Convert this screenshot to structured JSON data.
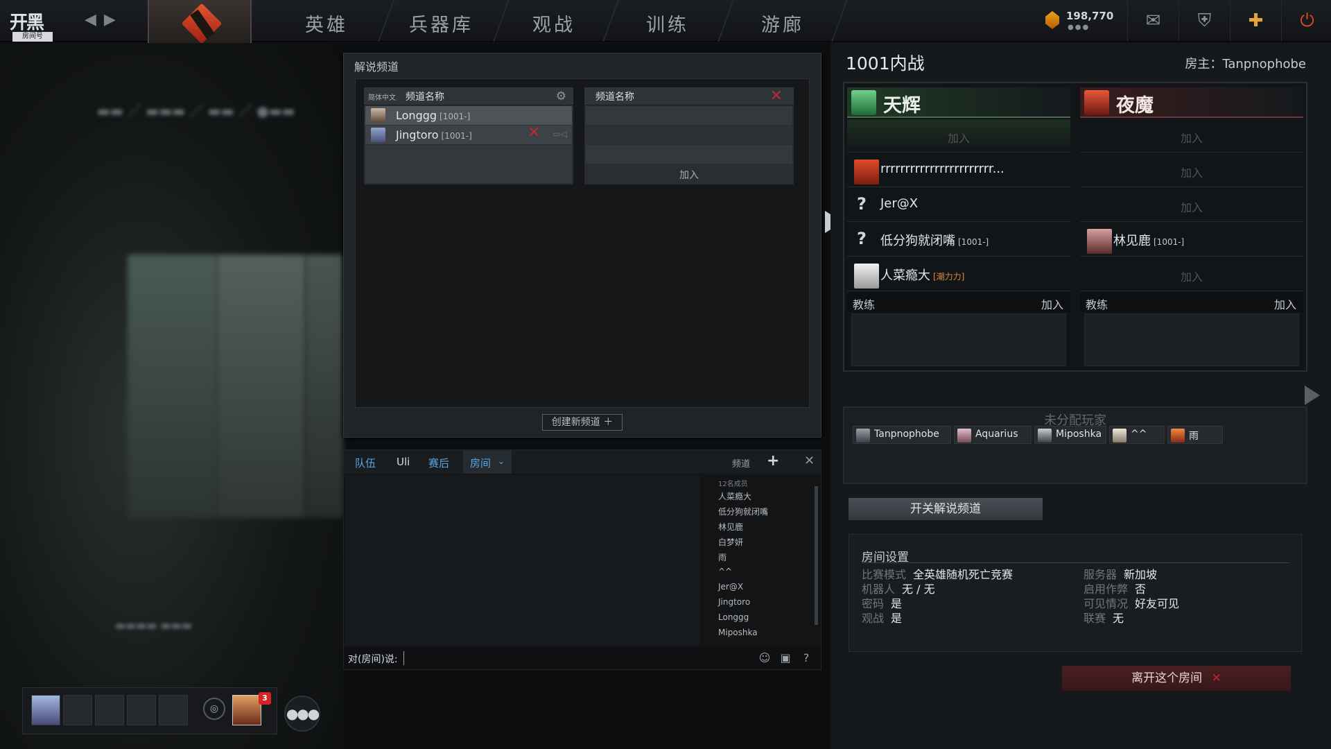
{
  "topbar": {
    "logo_text": "开黑",
    "logo_badge": "房间号",
    "logo_id": "314761",
    "tabs": [
      "英雄",
      "兵器库",
      "观战",
      "训练",
      "游廊"
    ],
    "gold": "198,770",
    "gold_dots": "●●●",
    "icons": [
      "mail-icon",
      "shield-icon",
      "plus-icon",
      "power-icon"
    ]
  },
  "commentary": {
    "title": "解说频道",
    "channel1": {
      "lang": "简体中文",
      "name": "频道名称",
      "members": [
        {
          "name": "Longgg",
          "tag": "[1001-]"
        },
        {
          "name": "Jingtoro",
          "tag": "[1001-]"
        }
      ]
    },
    "channel2": {
      "name": "频道名称",
      "join": "加入"
    },
    "create_btn": "创建新频道 ＋"
  },
  "chat": {
    "tabs": [
      "队伍",
      "Uli",
      "赛后",
      "房间"
    ],
    "channels_label": "频道",
    "member_count": "12名成员",
    "members": [
      "人菜瘾大",
      "低分狗就闭嘴",
      "林见鹿",
      "白梦妍",
      "雨",
      "^^",
      "Jer@X",
      "Jingtoro",
      "Longgg",
      "Miposhka"
    ],
    "input_label": "对(房间)说:"
  },
  "lobby": {
    "title": "1001内战",
    "host": "房主：Tanpnophobe",
    "radiant": {
      "name": "天辉",
      "color": "#e8f0e8",
      "slots": [
        {
          "type": "join",
          "label": "加入"
        },
        {
          "type": "player",
          "name": "rrrrrrrrrrrrrrrrrrrrrrr...",
          "tag": ""
        },
        {
          "type": "unknown",
          "name": "Jer@X",
          "tag": ""
        },
        {
          "type": "unknown",
          "name": "低分狗就闭嘴",
          "tag": "[1001-]"
        },
        {
          "type": "player",
          "name": "人菜瘾大",
          "tag": "[潮力力]"
        }
      ]
    },
    "dire": {
      "name": "夜魔",
      "color": "#f2e6e6",
      "slots": [
        {
          "type": "join",
          "label": "加入"
        },
        {
          "type": "join",
          "label": "加入"
        },
        {
          "type": "join",
          "label": "加入"
        },
        {
          "type": "player",
          "name": "林见鹿",
          "tag": "[1001-]"
        },
        {
          "type": "join",
          "label": "加入"
        }
      ]
    },
    "coach_label": "教练",
    "coach_join": "加入",
    "unassigned_title": "未分配玩家",
    "unassigned": [
      "Tanpnophobe",
      "Aquarius",
      "Miposhka",
      "^^",
      "雨"
    ],
    "toggle_commentary": "开关解说频道",
    "settings_title": "房间设置",
    "settings": [
      {
        "k": "比赛模式",
        "v": "全英雄随机死亡竞赛"
      },
      {
        "k": "机器人",
        "v": "无 / 无"
      },
      {
        "k": "密码",
        "v": "是"
      },
      {
        "k": "观战",
        "v": "是"
      },
      {
        "k": "服务器",
        "v": "新加坡"
      },
      {
        "k": "启用作弊",
        "v": "否"
      },
      {
        "k": "可见情况",
        "v": "好友可见"
      },
      {
        "k": "联赛",
        "v": "无"
      }
    ],
    "leave_btn": "离开这个房间"
  },
  "party": {
    "notification_count": "3"
  },
  "colors": {
    "accent_blue": "#5aa5e0",
    "leave_red": "#4a1f22",
    "gold": "#f2a01d",
    "tag_orange": "#e08a3a"
  }
}
